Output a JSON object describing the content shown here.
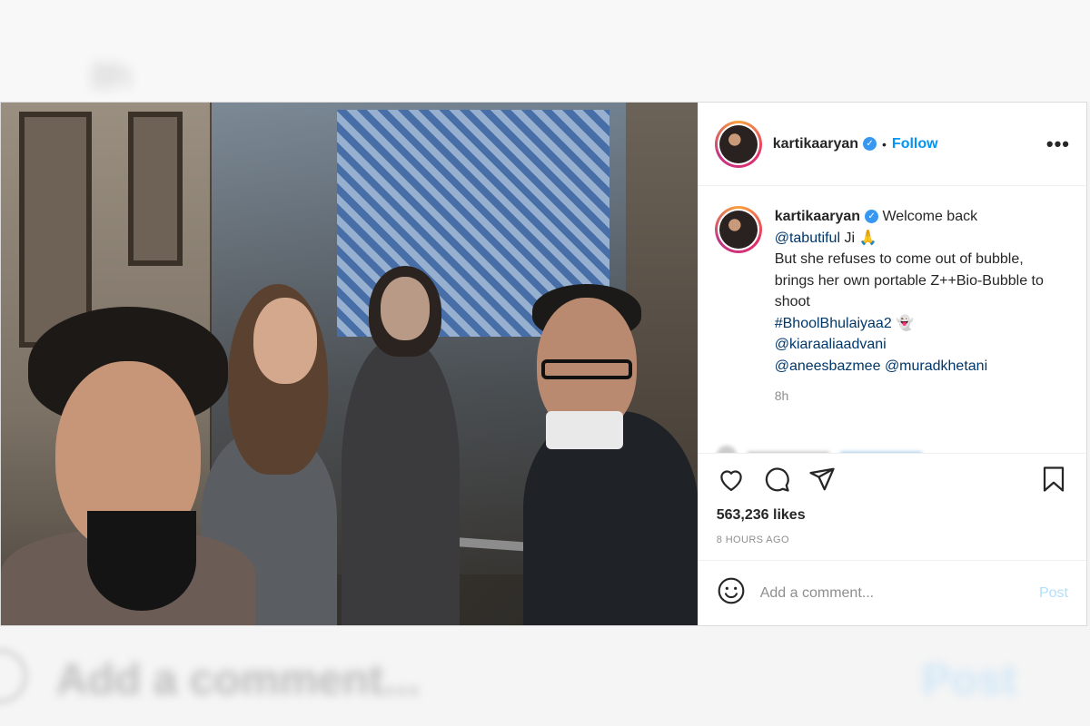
{
  "backdrop": {
    "time": "8h",
    "add_comment": "Add a comment...",
    "post": "Post"
  },
  "post": {
    "username": "kartikaaryan",
    "follow_label": "Follow",
    "separator": "•",
    "more_label": "•••",
    "caption": {
      "username": "kartikaaryan",
      "line1": "Welcome back",
      "mention1": "@tabutiful",
      "after_mention1": " Ji 🙏",
      "line3": "But she refuses to come out of bubble, brings her own portable Z++Bio-Bubble to shoot",
      "hashtag": "#BhoolBhulaiyaa2",
      "hashtag_emoji": "👻",
      "mention2": "@kiaraaliaadvani",
      "mention3": "@aneesbazmee",
      "mention4": "@muradkhetani"
    },
    "time_ago_short": "8h",
    "likes": "563,236 likes",
    "time_ago_long": "8 HOURS AGO",
    "comment_placeholder": "Add a comment...",
    "post_label": "Post"
  },
  "icons": {
    "like": "heart-icon",
    "comment": "comment-icon",
    "share": "share-icon",
    "save": "bookmark-icon",
    "emoji": "emoji-icon",
    "verified": "verified-badge-icon"
  },
  "colors": {
    "link": "#0095f6",
    "mention": "#00376b",
    "muted": "#8e8e8e",
    "post_disabled": "#b2dffc",
    "verified": "#3897f0"
  }
}
